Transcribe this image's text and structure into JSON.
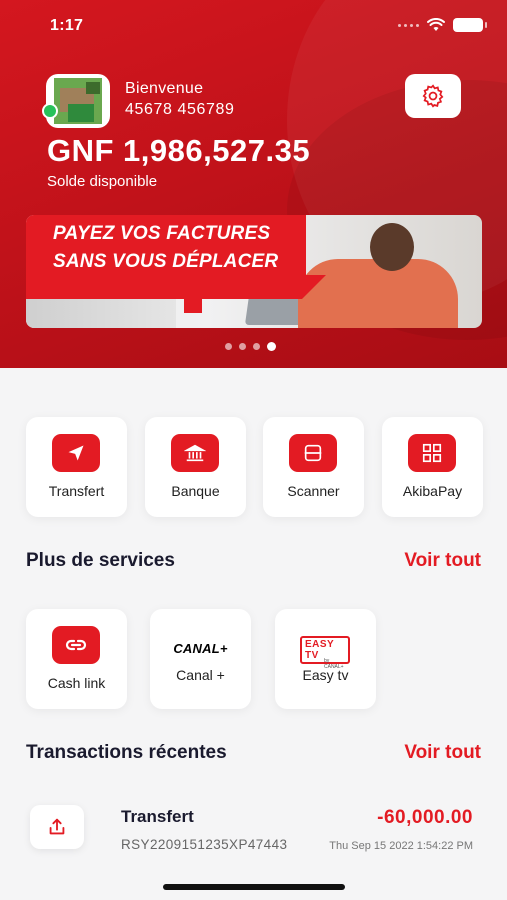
{
  "status_bar": {
    "time": "1:17"
  },
  "profile": {
    "greeting": "Bienvenue",
    "phone": "45678 456789",
    "balance": "GNF 1,986,527.35",
    "balance_label": "Solde disponible"
  },
  "banner": {
    "line1": "PAYEZ VOS FACTURES",
    "line2": "SANS VOUS DÉPLACER",
    "pages": 4,
    "active_page": 4
  },
  "quick_actions": [
    {
      "label": "Transfert",
      "icon": "send-icon"
    },
    {
      "label": "Banque",
      "icon": "bank-icon"
    },
    {
      "label": "Scanner",
      "icon": "scan-icon"
    },
    {
      "label": "AkibaPay",
      "icon": "qr-code-icon"
    }
  ],
  "services": {
    "title": "Plus de services",
    "see_all": "Voir tout",
    "items": [
      {
        "label": "Cash link",
        "icon": "link-icon"
      },
      {
        "label": "Canal +",
        "logo_text": "CANAL+"
      },
      {
        "label": "Easy tv",
        "logo_text": "EASY TV",
        "logo_sub": "by CANAL+"
      }
    ]
  },
  "transactions": {
    "title": "Transactions récentes",
    "see_all": "Voir tout",
    "items": [
      {
        "type": "Transfert",
        "reference": "RSY2209151235XP47443",
        "amount": "-60,000.00",
        "date": "Thu Sep 15 2022 1:54:22 PM",
        "icon": "upload-icon"
      }
    ]
  },
  "colors": {
    "brand_red": "#e31b23",
    "header_red": "#c1121a",
    "background": "#f5f5f6",
    "text_dark": "#1a1a2e"
  }
}
